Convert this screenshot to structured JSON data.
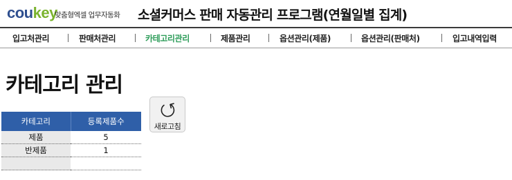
{
  "header": {
    "logo_part1": "cou",
    "logo_part2": "key",
    "tagline": "맞춤형엑셀 업무자동화",
    "app_title": "소셜커머스 판매 자동관리 프로그램(연월일별 집계)"
  },
  "nav": {
    "items": [
      {
        "label": "입고처관리"
      },
      {
        "label": "판매처관리"
      },
      {
        "label": "카테고리관리",
        "active": true
      },
      {
        "label": "제품관리"
      },
      {
        "label": "옵션관리(제품)"
      },
      {
        "label": "옵션관리(판매처)"
      },
      {
        "label": "입고내역입력"
      }
    ]
  },
  "page": {
    "title": "카테고리 관리"
  },
  "table": {
    "headers": [
      "카테고리",
      "등록제품수"
    ],
    "rows": [
      [
        "제품",
        "5"
      ],
      [
        "반제품",
        "1"
      ],
      [
        "",
        ""
      ]
    ]
  },
  "refresh_button": {
    "label": "새로고침",
    "icon": "refresh-icon"
  },
  "colors": {
    "accent": "#2e9d5a",
    "table_header": "#2f5fa8",
    "logo_blue": "#2f4f8f",
    "logo_green": "#7ab32e"
  }
}
